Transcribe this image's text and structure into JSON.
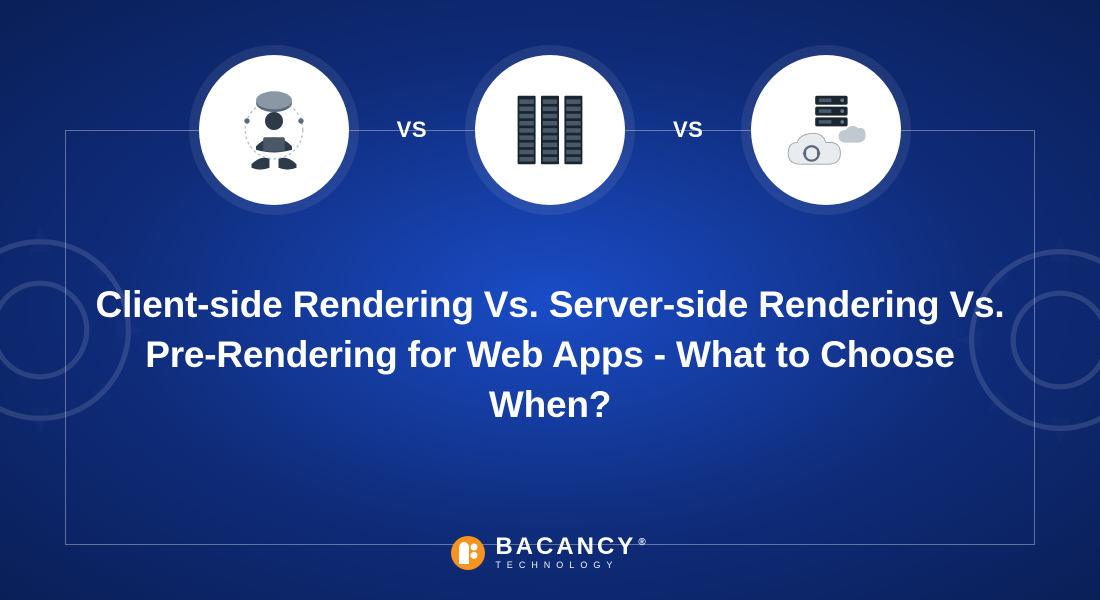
{
  "vs_label_1": "VS",
  "vs_label_2": "VS",
  "headline": "Client-side Rendering Vs. Server-side Rendering Vs. Pre-Rendering for Web Apps - What to Choose When?",
  "icons": {
    "client": "client-user-icon",
    "server": "server-rack-icon",
    "pre": "cloud-sync-server-icon"
  },
  "brand": {
    "name": "BACANCY",
    "tagline": "TECHNOLOGY",
    "registered": "®"
  },
  "colors": {
    "bg_center": "#1a4cc7",
    "bg_edge": "#0a1f57",
    "accent": "#f7931e",
    "white": "#ffffff"
  }
}
